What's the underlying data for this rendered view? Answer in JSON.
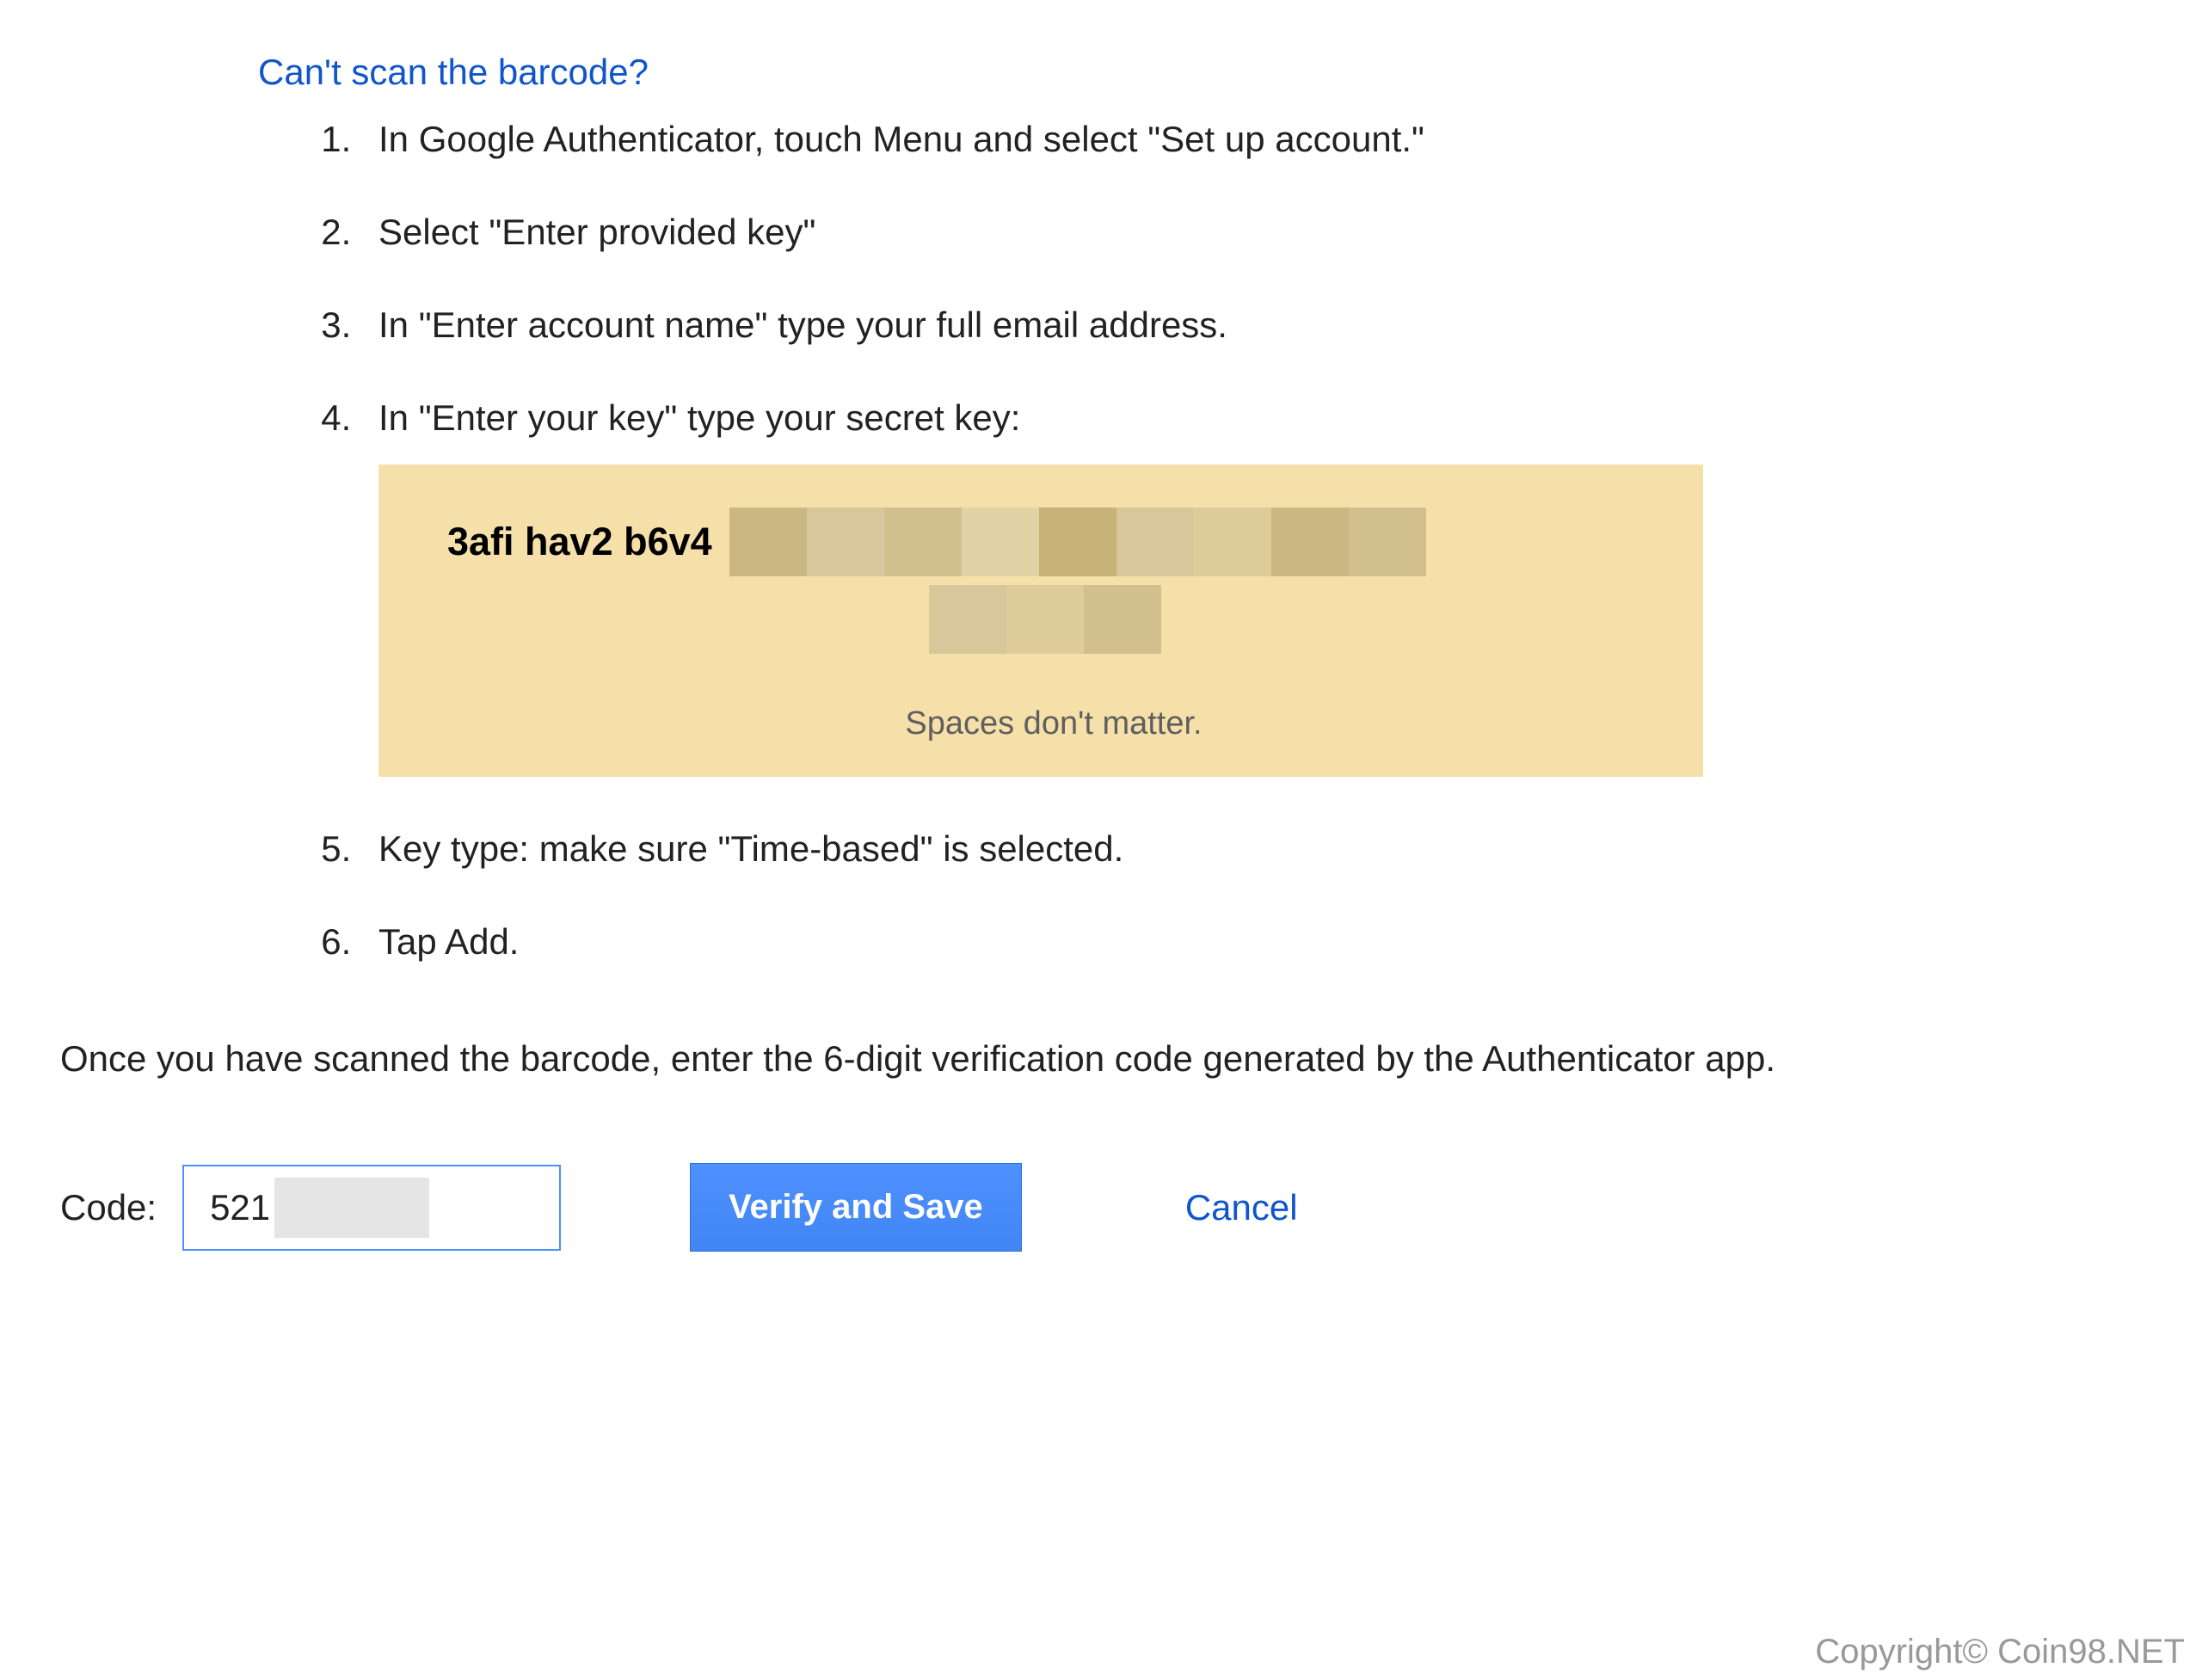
{
  "heading": "Can't scan the barcode?",
  "steps": {
    "s1": "In Google Authenticator, touch Menu and select \"Set up account.\"",
    "s2": "Select \"Enter provided key\"",
    "s3": "In \"Enter account name\" type your full email address.",
    "s4": "In \"Enter your key\" type your secret key:",
    "s5": "Key type: make sure \"Time-based\" is selected.",
    "s6": "Tap Add."
  },
  "secret_key": {
    "visible": "3afi hav2 b6v4",
    "hint": "Spaces don't matter."
  },
  "instruction": "Once you have scanned the barcode, enter the 6-digit verification code generated by the Authenticator app.",
  "form": {
    "label": "Code:",
    "value": "521",
    "verify_label": "Verify and Save",
    "cancel_label": "Cancel"
  },
  "copyright": "Copyright© Coin98.NET"
}
